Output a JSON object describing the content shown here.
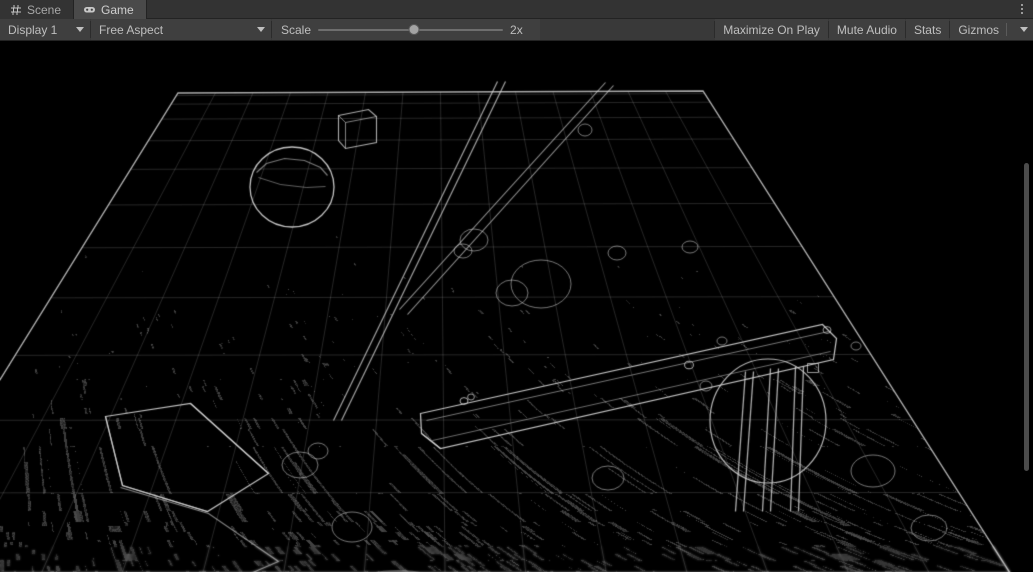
{
  "window": {
    "title": "Game",
    "overflow_menu_icon": "kebab-menu-icon"
  },
  "tabs": [
    {
      "label": "Scene",
      "icon": "grid-icon",
      "active": false
    },
    {
      "label": "Game",
      "icon": "gamepad-icon",
      "active": true
    }
  ],
  "toolbar": {
    "display": {
      "label": "Display 1",
      "icon": "chevron-down-icon"
    },
    "aspect": {
      "label": "Free Aspect",
      "icon": "chevron-down-icon"
    },
    "scale": {
      "label": "Scale",
      "value": "2x",
      "slider_percent": 52
    },
    "maximize_on_play": "Maximize On Play",
    "mute_audio": "Mute Audio",
    "stats": "Stats",
    "gizmos": {
      "label": "Gizmos",
      "icon": "chevron-down-icon"
    }
  },
  "gameview": {
    "background_color": "#000000",
    "edge_color": "#d8d8d8",
    "description": "Edge-detection post-process render of a 3D scene: a large trapezoidal ground plane in perspective covered in dense noisy outline detail, with a sphere, several boxes, crossing diagonal poles, a long ramp slab and cylindrical pillars.",
    "scrollbar": {
      "thumb_top_percent": 23,
      "thumb_height_percent": 58,
      "color": "#4b4b4b"
    }
  }
}
